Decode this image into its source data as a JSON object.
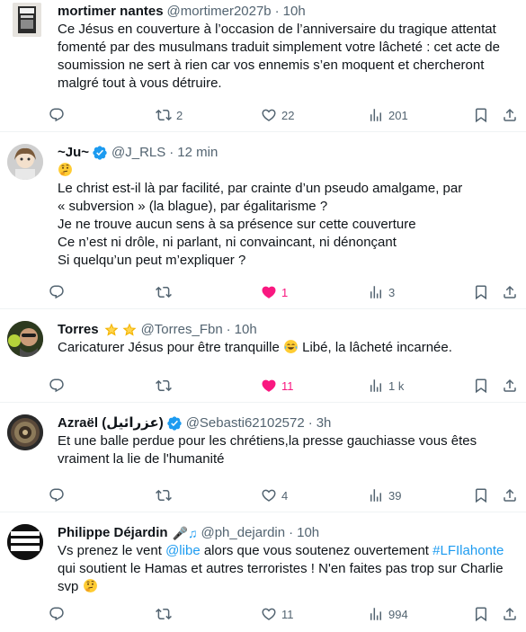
{
  "tweets": [
    {
      "name": "mortimer nantes",
      "handle": "@mortimer2027b",
      "time": "10h",
      "lines": [
        "Ce Jésus en couverture à l’occasion de l’anniversaire du tragique attentat",
        "fomenté par des musulmans traduit simplement votre lâcheté : cet acte de",
        "soumission ne sert à rien car vos ennemis s’en moquent et chercheront",
        "malgré tout à vous détruire."
      ],
      "replies": "",
      "retweets": "2",
      "likes": "22",
      "views": "201"
    },
    {
      "name": "~Ju~",
      "handle": "@J_RLS",
      "time": "12 min",
      "emoji_line": "thinking-face",
      "lines": [
        "Le christ est-il là par facilité, par crainte d’un pseudo amalgame, par",
        "« subversion » (la blague), par égalitarisme ?",
        "Je ne trouve aucun sens à sa présence sur cette couverture",
        "Ce n’est ni drôle, ni parlant, ni convaincant, ni dénonçant",
        "Si quelqu’un peut m’expliquer ?"
      ],
      "replies": "",
      "retweets": "",
      "likes": "1",
      "views": "3"
    },
    {
      "name": "Torres",
      "handle": "@Torres_Fbn",
      "time": "10h",
      "text_before_emoji": "Caricaturer Jésus pour être tranquille ",
      "text_after_emoji": " Libé, la lâcheté incarnée.",
      "replies": "",
      "retweets": "",
      "likes": "11",
      "views": "1 k"
    },
    {
      "name": "Azraël (عزرائيل)",
      "handle": "@Sebasti62102572",
      "time": "3h",
      "lines": [
        "Et une balle perdue pour les chrétiens,la presse gauchiasse vous êtes",
        "vraiment la lie de l'humanité"
      ],
      "replies": "",
      "retweets": "",
      "likes": "4",
      "views": "39"
    },
    {
      "name": "Philippe Déjardin",
      "handle": "@ph_dejardin",
      "time": "10h",
      "l1_a": "Vs prenez le vent ",
      "l1_mention": "@libe",
      "l1_b": " alors que vous soutenez ouvertement ",
      "l1_hashtag": "#LFIlahonte",
      "l2": "qui soutient le Hamas et autres terroristes ! N'en faites pas trop sur Charlie",
      "l3": "svp ",
      "replies": "",
      "retweets": "",
      "likes": "11",
      "views": "994"
    }
  ],
  "colors": {
    "text": "#0f1419",
    "muted": "#536471",
    "link": "#1d9bf0",
    "like_active": "#f91880",
    "verified": "#1d9bf0",
    "divider": "#eff3f4"
  }
}
